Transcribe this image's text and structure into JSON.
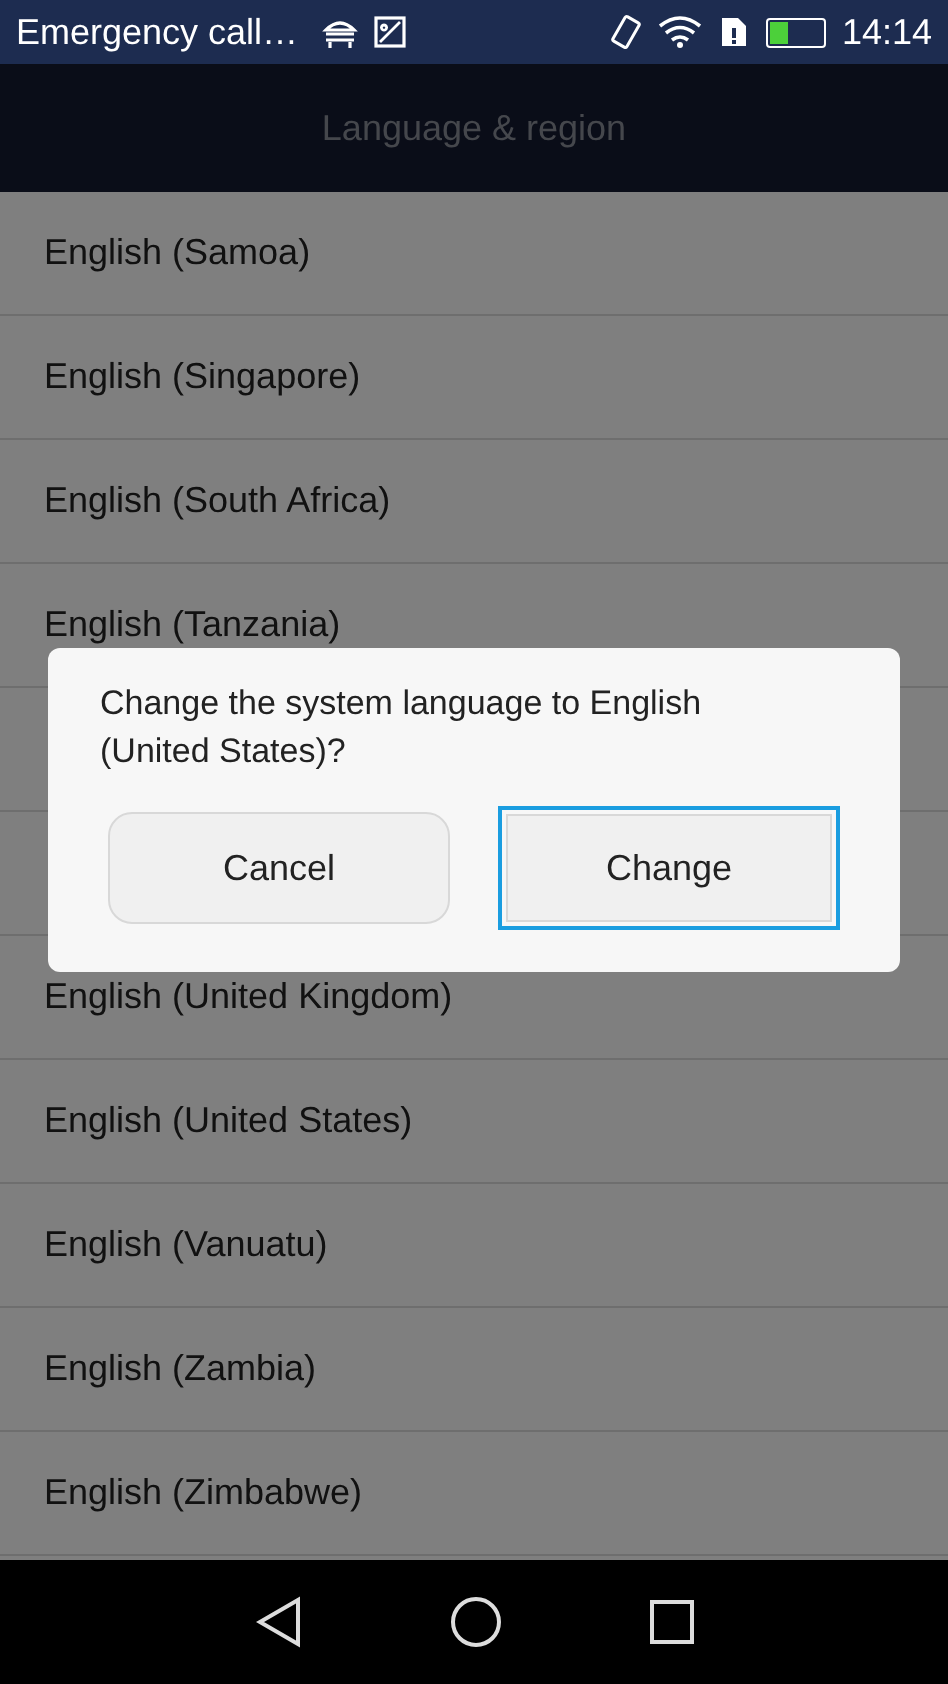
{
  "status_bar": {
    "carrier": "Emergency call…",
    "time": "14:14"
  },
  "title": "Language & region",
  "languages": [
    {
      "kind": "row",
      "label": "English (Samoa)"
    },
    {
      "kind": "row",
      "label": "English (Singapore)"
    },
    {
      "kind": "row",
      "label": "English (South Africa)"
    },
    {
      "kind": "row",
      "label": "English (Tanzania)"
    },
    {
      "kind": "covered"
    },
    {
      "kind": "covered"
    },
    {
      "kind": "row",
      "label": "English (United Kingdom)"
    },
    {
      "kind": "row",
      "label": "English (United States)"
    },
    {
      "kind": "row",
      "label": "English (Vanuatu)"
    },
    {
      "kind": "row",
      "label": "English (Zambia)"
    },
    {
      "kind": "row",
      "label": "English (Zimbabwe)"
    }
  ],
  "dialog": {
    "message": "Change the system language to English (United States)?",
    "buttons": [
      {
        "label": "Cancel",
        "focused": false
      },
      {
        "label": "Change",
        "focused": true
      }
    ]
  }
}
